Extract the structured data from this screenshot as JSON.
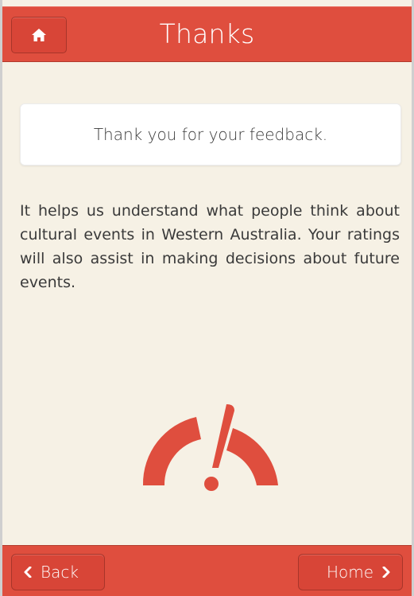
{
  "header": {
    "title": "Thanks",
    "home_icon": "home-icon"
  },
  "main": {
    "card_text": "Thank you for your feedback.",
    "body_text": "It helps us understand what people think about cultural events in Western Australia. Your ratings will also assist in making decisions about future events.",
    "logo_icon": "gauge-exclamation-logo"
  },
  "footer": {
    "back_label": "Back",
    "home_label": "Home",
    "back_icon": "chevron-left-icon",
    "home_icon": "chevron-right-icon"
  },
  "colors": {
    "accent": "#df4e3e",
    "background": "#f6f1e5",
    "text": "#3a3a3a"
  }
}
